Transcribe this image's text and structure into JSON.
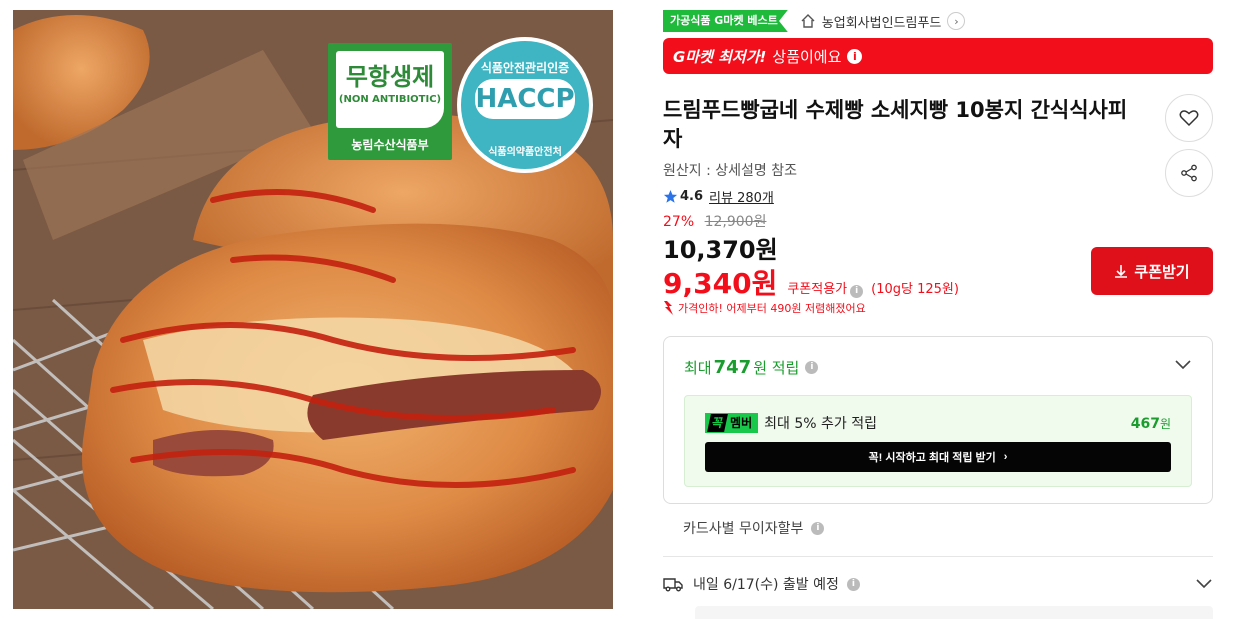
{
  "image": {
    "badge_antibiotic": {
      "title": "무항생제",
      "subtitle": "(NON ANTIBIOTIC)",
      "footer": "농림수산식품부"
    },
    "badge_haccp": {
      "top": "식품안전관리인증",
      "main": "HACCP",
      "bottom": "식품의약품안전처"
    }
  },
  "tag": {
    "best_label": "가공식품 G마켓 베스트"
  },
  "seller": {
    "name": "농업회사법인드림푸드",
    "icon": "home-icon"
  },
  "banner": {
    "strong": "G마켓 최저가!",
    "text": "상품이에요",
    "color": "#f20f1b"
  },
  "product": {
    "title": "드림푸드빵굽네 수제빵 소세지빵 10봉지 간식식사피자",
    "origin": "원산지 : 상세설명 참조",
    "rating": "4.6",
    "review": "리뷰 280개"
  },
  "price": {
    "discount_rate": "27%",
    "original": "12,900원",
    "sale": "10,370원",
    "coupon_price": "9,340원",
    "coupon_label": "쿠폰적용가",
    "unit_price": "(10g당 125원)",
    "drop_notice": "가격인하! 어제부터 490원 저렴해졌어요"
  },
  "buttons": {
    "coupon": "쿠폰받기"
  },
  "points": {
    "prefix": "최대",
    "amount": "747",
    "suffix": "원 적립",
    "member_logo_a": "꼭",
    "member_logo_b": "멤버",
    "member_text": "최대 5% 추가 적립",
    "member_points": "467",
    "member_points_unit": "원",
    "cta": "꼭! 시작하고 최대 적립 받기",
    "accent": "#1a9c2e"
  },
  "installment": "카드사별 무이자할부",
  "delivery": "내일 6/17(수) 출발 예정"
}
